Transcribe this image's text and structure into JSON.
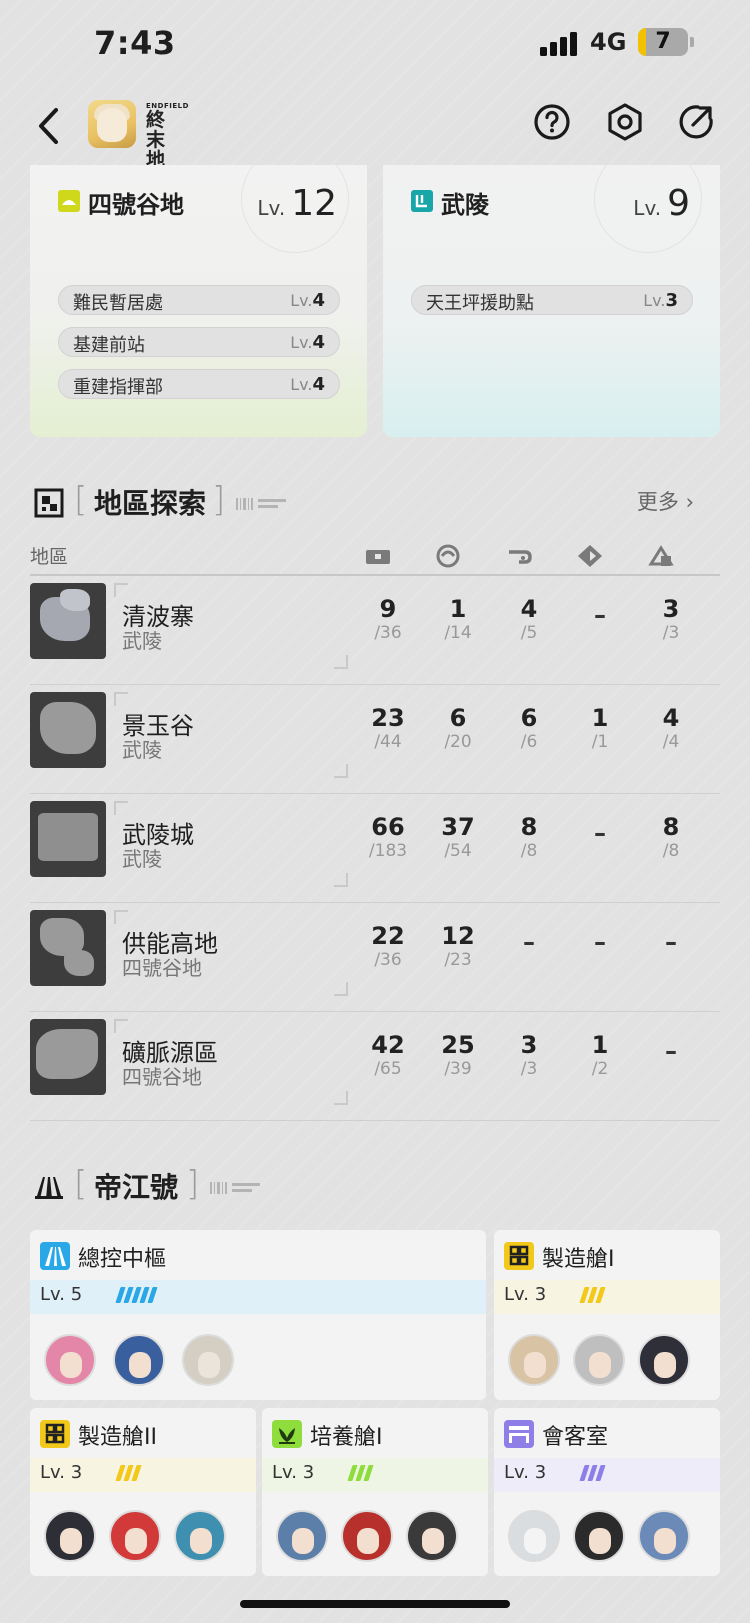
{
  "status_bar": {
    "time": "7:43",
    "network": "4G",
    "battery": "7"
  },
  "nav": {
    "app_logo_text": "終末地",
    "app_logo_sub": "ENDFIELD"
  },
  "regions": [
    {
      "name": "四號谷地",
      "lv_prefix": "Lv.",
      "level": "12",
      "tag_color": "#cfd81a",
      "facilities": [
        {
          "name": "難民暫居處",
          "lv_prefix": "Lv.",
          "level": "4"
        },
        {
          "name": "基建前站",
          "lv_prefix": "Lv.",
          "level": "4"
        },
        {
          "name": "重建指揮部",
          "lv_prefix": "Lv.",
          "level": "4"
        }
      ]
    },
    {
      "name": "武陵",
      "lv_prefix": "Lv.",
      "level": "9",
      "tag_color": "#19a6a8",
      "facilities": [
        {
          "name": "天王坪援助點",
          "lv_prefix": "Lv.",
          "level": "3"
        }
      ]
    }
  ],
  "exploration": {
    "title": "地區探索",
    "more": "更多",
    "column_header": "地區",
    "icons": [
      "chest-icon",
      "swirl-icon",
      "hook-icon",
      "diamond-arrow-icon",
      "puzzle-icon"
    ],
    "rows": [
      {
        "name": "清波寨",
        "region": "武陵",
        "stats": [
          {
            "v": "9",
            "t": "36"
          },
          {
            "v": "1",
            "t": "14"
          },
          {
            "v": "4",
            "t": "5"
          },
          {
            "v": "–",
            "t": ""
          },
          {
            "v": "3",
            "t": "3"
          }
        ]
      },
      {
        "name": "景玉谷",
        "region": "武陵",
        "stats": [
          {
            "v": "23",
            "t": "44"
          },
          {
            "v": "6",
            "t": "20"
          },
          {
            "v": "6",
            "t": "6"
          },
          {
            "v": "1",
            "t": "1"
          },
          {
            "v": "4",
            "t": "4"
          }
        ]
      },
      {
        "name": "武陵城",
        "region": "武陵",
        "stats": [
          {
            "v": "66",
            "t": "183"
          },
          {
            "v": "37",
            "t": "54"
          },
          {
            "v": "8",
            "t": "8"
          },
          {
            "v": "–",
            "t": ""
          },
          {
            "v": "8",
            "t": "8"
          }
        ]
      },
      {
        "name": "供能高地",
        "region": "四號谷地",
        "stats": [
          {
            "v": "22",
            "t": "36"
          },
          {
            "v": "12",
            "t": "23"
          },
          {
            "v": "–",
            "t": ""
          },
          {
            "v": "–",
            "t": ""
          },
          {
            "v": "–",
            "t": ""
          }
        ]
      },
      {
        "name": "礦脈源區",
        "region": "四號谷地",
        "stats": [
          {
            "v": "42",
            "t": "65"
          },
          {
            "v": "25",
            "t": "39"
          },
          {
            "v": "3",
            "t": "3"
          },
          {
            "v": "1",
            "t": "2"
          },
          {
            "v": "–",
            "t": ""
          }
        ]
      }
    ]
  },
  "ship": {
    "title": "帝江號",
    "rooms": [
      {
        "name": "總控中樞",
        "level_text": "Lv. 5",
        "bars": 5,
        "color": "#2aa7e6",
        "band": "#e0f0f9"
      },
      {
        "name": "製造艙I",
        "level_text": "Lv. 3",
        "bars": 3,
        "color": "#f2c91a",
        "band": "#f7f4e2"
      },
      {
        "name": "製造艙II",
        "level_text": "Lv. 3",
        "bars": 3,
        "color": "#f2c91a",
        "band": "#f7f4e2"
      },
      {
        "name": "培養艙I",
        "level_text": "Lv. 3",
        "bars": 3,
        "color": "#8fdd3c",
        "band": "#eef5e4"
      },
      {
        "name": "會客室",
        "level_text": "Lv. 3",
        "bars": 3,
        "color": "#8e7fe8",
        "band": "#eeecf8"
      }
    ]
  }
}
